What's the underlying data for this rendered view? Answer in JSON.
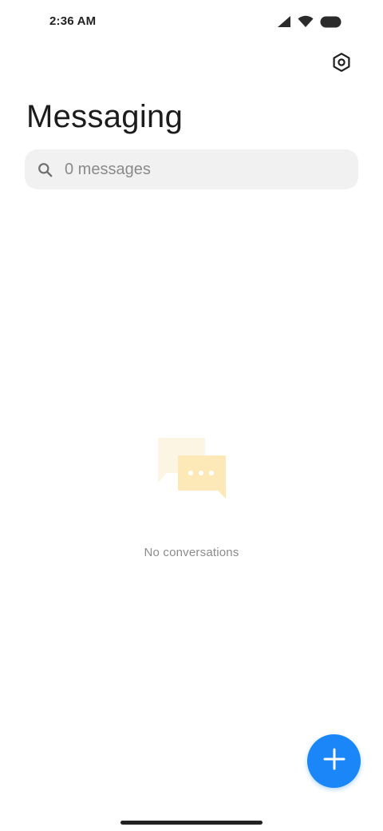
{
  "status_bar": {
    "time": "2:36 AM",
    "icons": [
      "signal-icon",
      "wifi-icon",
      "battery-icon"
    ]
  },
  "header": {
    "title": "Messaging",
    "settings_icon": "settings-icon"
  },
  "search": {
    "placeholder": "0 messages",
    "value": "",
    "icon": "search-icon"
  },
  "empty_state": {
    "icon": "chat-bubbles-icon",
    "text": "No conversations"
  },
  "fab": {
    "icon": "plus-icon"
  },
  "colors": {
    "accent": "#1a86f7",
    "illustration": "#fde9b8",
    "search_bg": "#f1f1f1"
  }
}
